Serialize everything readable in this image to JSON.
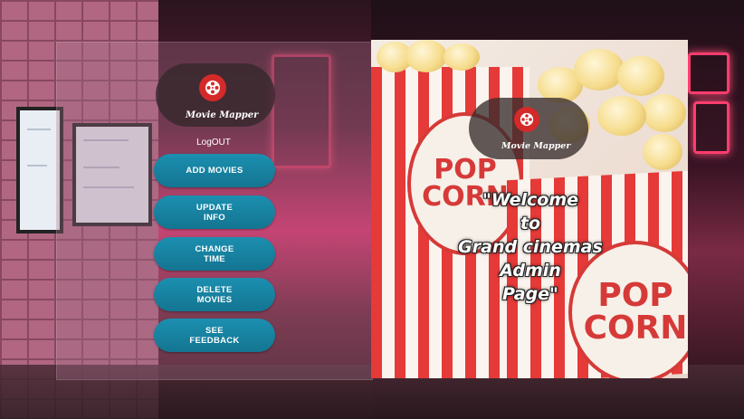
{
  "app": {
    "logo_text": "Movie Mapper",
    "logo_icon": "film-reel-icon",
    "accent_color": "#178aab",
    "logo_color": "#d42a2a"
  },
  "sidebar": {
    "logout_label": "LogOUT",
    "buttons": [
      {
        "label": "ADD MOVIES"
      },
      {
        "label": "UPDATE\nINFO"
      },
      {
        "label": "CHANGE\nTIME"
      },
      {
        "label": "DELETE\nMOVIES"
      },
      {
        "label": "SEE\nFEEDBACK"
      }
    ]
  },
  "hero": {
    "logo_text": "Movie Mapper",
    "welcome_text": "\"Welcome\nto\nGrand cinemas\nAdmin\nPage\"",
    "popcorn_label_1": "POP\nCORN",
    "popcorn_label_2": "POP\nCORN"
  }
}
